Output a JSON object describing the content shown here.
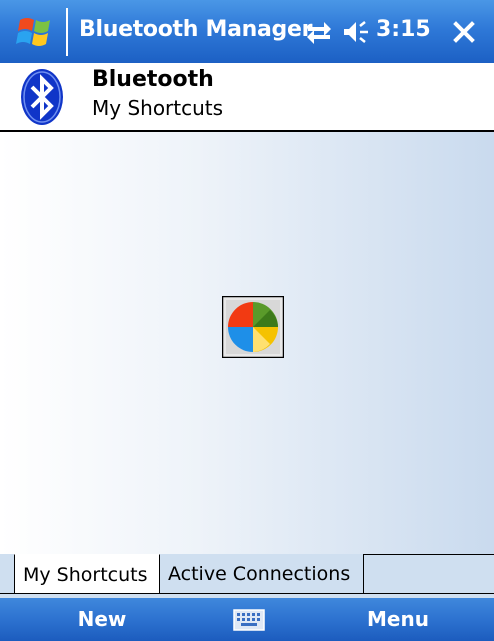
{
  "titlebar": {
    "title": "Bluetooth Manager",
    "clock": "3:15",
    "icons": [
      "windows-flag-icon",
      "connectivity-icon",
      "volume-icon",
      "close-icon"
    ]
  },
  "header": {
    "title": "Bluetooth",
    "subtitle": "My Shortcuts",
    "icon": "bluetooth-icon"
  },
  "content": {
    "icon": "windows-flag-tile-icon"
  },
  "tabs": [
    {
      "label": "My Shortcuts",
      "active": true
    },
    {
      "label": "Active Connections",
      "active": false
    }
  ],
  "softkeys": {
    "left": "New",
    "right": "Menu",
    "center_icon": "keyboard-icon"
  },
  "colors": {
    "titlebar": "#2f79d8",
    "softkeys": "#2d72d0",
    "tab_strip": "#cfdff0",
    "bluetooth_badge": "#1035c8"
  }
}
